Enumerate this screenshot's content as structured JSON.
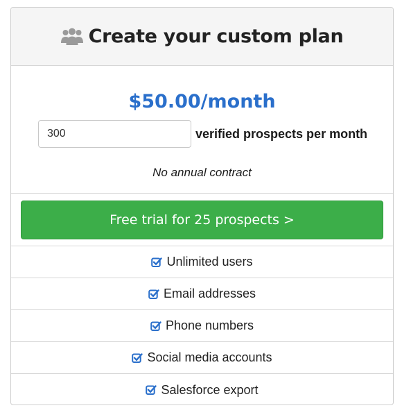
{
  "header": {
    "title": "Create your custom plan",
    "icon": "users-icon"
  },
  "pricing": {
    "price": "$50.00/month",
    "quantity_value": "300",
    "quantity_label": "verified prospects per month",
    "contract_note": "No annual contract"
  },
  "cta": {
    "label": "Free trial for 25 prospects >",
    "color": "#3cae49"
  },
  "features": [
    {
      "label": "Unlimited users",
      "icon": "checkbox-checked-icon"
    },
    {
      "label": "Email addresses",
      "icon": "checkbox-checked-icon"
    },
    {
      "label": "Phone numbers",
      "icon": "checkbox-checked-icon"
    },
    {
      "label": "Social media accounts",
      "icon": "checkbox-checked-icon"
    },
    {
      "label": "Salesforce export",
      "icon": "checkbox-checked-icon"
    }
  ],
  "colors": {
    "accent": "#2a6fcb",
    "header_bg": "#f5f5f5",
    "button_green": "#3cae49"
  }
}
